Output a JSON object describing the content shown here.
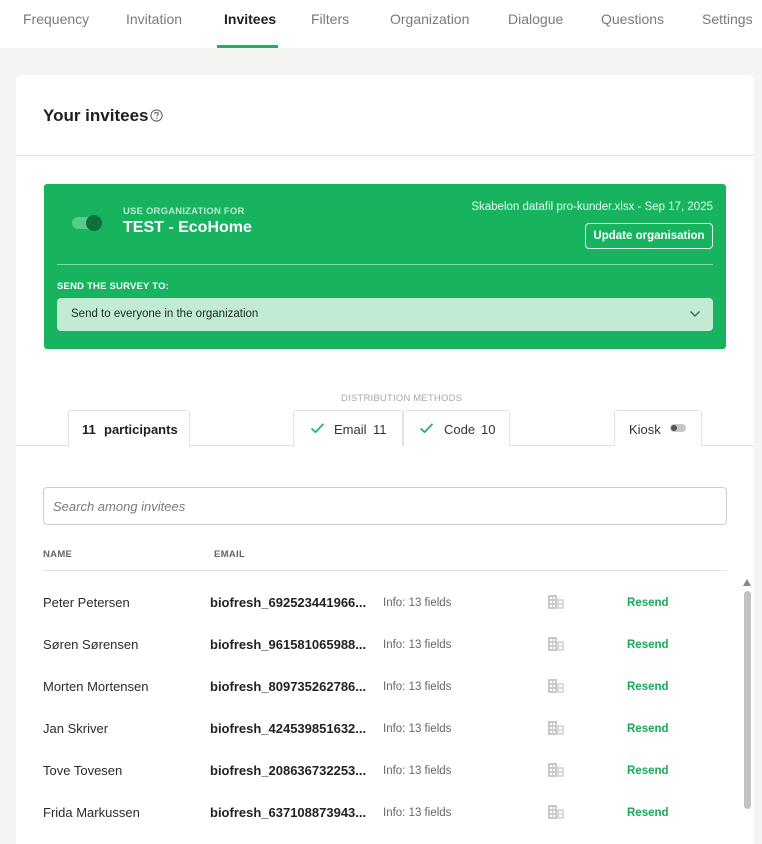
{
  "tabs": [
    {
      "label": "Frequency"
    },
    {
      "label": "Invitation"
    },
    {
      "label": "Invitees"
    },
    {
      "label": "Filters"
    },
    {
      "label": "Organization"
    },
    {
      "label": "Dialogue"
    },
    {
      "label": "Questions"
    },
    {
      "label": "Settings"
    }
  ],
  "active_tab": "Invitees",
  "card": {
    "title": "Your invitees",
    "help_icon": "question-circle-icon"
  },
  "organization": {
    "toggle_on": true,
    "label": "USE ORGANIZATION FOR",
    "name": "TEST - EcoHome",
    "file": "Skabelon datafil pro-kunder.xlsx - Sep 17, 2025",
    "update_button": "Update organisation",
    "send_label": "SEND THE SURVEY TO:",
    "send_value": "Send to everyone in the organization"
  },
  "distribution": {
    "label": "DISTRIBUTION METHODS",
    "participants_count": "11",
    "participants_label": "participants",
    "email_label": "Email",
    "email_count": "11",
    "code_label": "Code",
    "code_count": "10",
    "kiosk_label": "Kiosk",
    "kiosk_on": false
  },
  "search": {
    "placeholder": "Search among invitees"
  },
  "table": {
    "headers": {
      "name": "NAME",
      "email": "EMAIL"
    },
    "rows": [
      {
        "name": "Peter Petersen",
        "email": "biofresh_692523441966...",
        "info": "Info: 13 fields",
        "action": "Resend"
      },
      {
        "name": "Søren Sørensen",
        "email": "biofresh_961581065988...",
        "info": "Info: 13 fields",
        "action": "Resend"
      },
      {
        "name": "Morten Mortensen",
        "email": "biofresh_809735262786...",
        "info": "Info: 13 fields",
        "action": "Resend"
      },
      {
        "name": "Jan Skriver",
        "email": "biofresh_424539851632...",
        "info": "Info: 13 fields",
        "action": "Resend"
      },
      {
        "name": "Tove Tovesen",
        "email": "biofresh_208636732253...",
        "info": "Info: 13 fields",
        "action": "Resend"
      },
      {
        "name": "Frida Markussen",
        "email": "biofresh_637108873943...",
        "info": "Info: 13 fields",
        "action": "Resend"
      }
    ]
  },
  "colors": {
    "brand_green": "#17b35f",
    "select_bg": "#c2ebd4",
    "resend_green": "#17a85a"
  }
}
